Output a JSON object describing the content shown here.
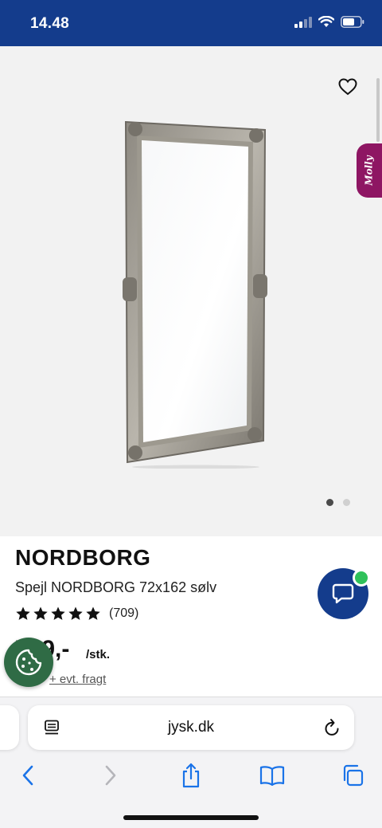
{
  "status_bar": {
    "time": "14.48"
  },
  "product": {
    "brand": "NORDBORG",
    "name": "Spejl NORDBORG 72x162 sølv",
    "rating_stars": 5,
    "review_count": "(709)",
    "price": "719,-",
    "price_unit": "/stk.",
    "freight_note": "+ evt. fragt"
  },
  "gallery": {
    "image_count": 2,
    "active_index": 0
  },
  "side_tab": {
    "label": "Molly"
  },
  "browser": {
    "url": "jysk.dk"
  },
  "colors": {
    "brand_blue": "#143c8c",
    "chat_online": "#2fc15a",
    "cookie_green": "#2f6b45",
    "molly_purple": "#8e1663"
  }
}
